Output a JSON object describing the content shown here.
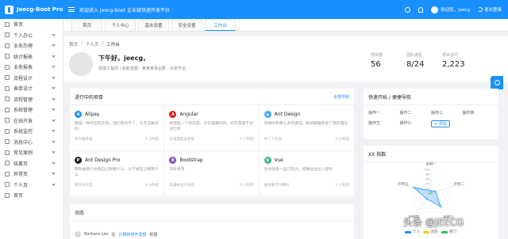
{
  "header": {
    "app_title": "Jeecg-Boot Pro",
    "welcome": "欢迎进入 Jeecg-Boot 企业级快速开发平台",
    "user_name": "欢迎您，jeecg",
    "logout": "退出登录"
  },
  "sidebar": {
    "items": [
      {
        "label": "首页",
        "icon": "home-icon",
        "chevron": false
      },
      {
        "label": "个人办公",
        "icon": "desktop-icon",
        "chevron": true
      },
      {
        "label": "业务办理",
        "icon": "briefcase-icon",
        "chevron": true
      },
      {
        "label": "统计报表",
        "icon": "chart-icon",
        "chevron": true
      },
      {
        "label": "业务报表",
        "icon": "report-icon",
        "chevron": true
      },
      {
        "label": "流程设计",
        "icon": "flow-icon",
        "chevron": true
      },
      {
        "label": "表单设计",
        "icon": "form-icon",
        "chevron": true
      },
      {
        "label": "流程管理",
        "icon": "process-icon",
        "chevron": true
      },
      {
        "label": "系统管理",
        "icon": "settings-icon",
        "chevron": true
      },
      {
        "label": "在线开发",
        "icon": "code-icon",
        "chevron": true
      },
      {
        "label": "系统监控",
        "icon": "monitor-icon",
        "chevron": true
      },
      {
        "label": "消息中心",
        "icon": "message-icon",
        "chevron": true
      },
      {
        "label": "常见案例",
        "icon": "case-icon",
        "chevron": true
      },
      {
        "label": "结果页",
        "icon": "check-icon",
        "chevron": true
      },
      {
        "label": "异常页",
        "icon": "warning-icon",
        "chevron": true
      },
      {
        "label": "个人页",
        "icon": "user-icon",
        "chevron": true
      },
      {
        "label": "首页",
        "icon": "home-icon",
        "chevron": false
      }
    ]
  },
  "tabs": [
    {
      "label": "首页",
      "active": false
    },
    {
      "label": "个人中心",
      "active": false
    },
    {
      "label": "基本设置",
      "active": false
    },
    {
      "label": "安全设置",
      "active": false
    },
    {
      "label": "工作台",
      "active": true
    }
  ],
  "page": {
    "breadcrumb": [
      "首页",
      "个人页",
      "工作台"
    ],
    "greeting": "下午好，jeecg，",
    "subline": "前端工程师 | 蚂蚁金服 - 某某某事业群 - VUE平台",
    "stats": [
      {
        "label": "项目数",
        "value": "56"
      },
      {
        "label": "团队排名",
        "value": "8/24"
      },
      {
        "label": "项目访问",
        "value": "2,223"
      }
    ]
  },
  "projects": {
    "title": "进行中的项目",
    "link": "全部项目",
    "items": [
      {
        "name": "Alipay",
        "icon_letter": "A",
        "color": "#1890ff",
        "desc": "那是一种内在的东西，他们到达不了，也无法触及的",
        "team": "科学搬砖组",
        "time": "3 小时前"
      },
      {
        "name": "Angular",
        "icon_letter": "A",
        "color": "#dd1b16",
        "desc": "希望是一个好东西，也许是最好的，好东西是不会消亡的",
        "team": "全组都是吴彦祖",
        "time": "3 小时前"
      },
      {
        "name": "Ant Design",
        "icon_letter": "◆",
        "color": "#40a9ff",
        "desc": "城镇中有那么多的酒馆，她却偏偏走进了我的酒馆",
        "team": "中二少女团",
        "time": "3 小时前"
      },
      {
        "name": "Ant Design Pro",
        "icon_letter": "P",
        "color": "#222222",
        "desc": "那时候我只会想自己想要什么，从不想自己拥有什么",
        "team": "程序员日常",
        "time": "3 小时前"
      },
      {
        "name": "Bootstrap",
        "icon_letter": "B",
        "color": "#7952b3",
        "desc": "凛冬将至",
        "team": "高逼格设计天团",
        "time": "3 小时前"
      },
      {
        "name": "Vue",
        "icon_letter": "V",
        "color": "#41b883",
        "desc": "生命就像一盒巧克力，结果往往出人意料",
        "team": "骗你来学计算机",
        "time": "3 小时前"
      }
    ]
  },
  "dynamics": {
    "title": "动态",
    "entry_user": "Barbara Lee",
    "entry_verb": "在",
    "entry_target": "计算新增开发部",
    "entry_tail": "新建"
  },
  "quick": {
    "title": "快速开始 / 便捷导航",
    "items": [
      "操作一",
      "操作二",
      "操作三",
      "操作四",
      "操作五",
      "操作六"
    ],
    "add_label": "+ 添加"
  },
  "index_card": {
    "title": "XX 指数",
    "chart_data": {
      "type": "radar",
      "axes": [
        "示例一",
        "示例二",
        "示例三",
        "示例四",
        "示例五"
      ],
      "ticks": [
        "0",
        "20",
        "40",
        "60",
        "80",
        "100"
      ],
      "max": 100,
      "series": [
        {
          "name": "个人",
          "color": "#1890ff",
          "values": [
            10,
            20,
            70,
            30,
            75
          ]
        },
        {
          "name": "团队",
          "color": "#facc14",
          "values": [
            0,
            0,
            0,
            0,
            0
          ]
        },
        {
          "name": "部门",
          "color": "#2fc25b",
          "values": [
            0,
            0,
            0,
            0,
            0
          ]
        }
      ]
    }
  },
  "watermark": "头条 @JEECG"
}
